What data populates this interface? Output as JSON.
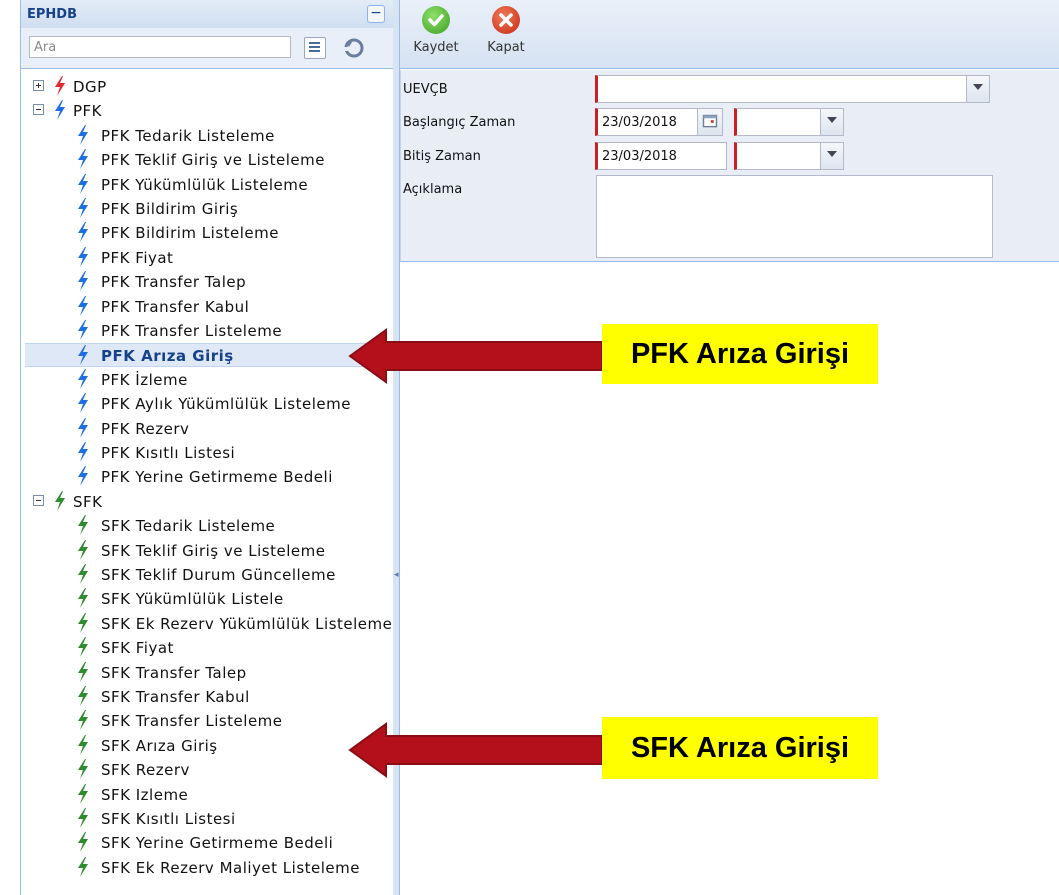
{
  "left_panel": {
    "title": "EPHDB",
    "search_placeholder": "Ara"
  },
  "tree": {
    "nodes": [
      {
        "label": "DGP",
        "level": 0,
        "expander": "plus",
        "bolt": "#e0262e"
      },
      {
        "label": "PFK",
        "level": 0,
        "expander": "minus",
        "bolt": "#1f6fe0"
      },
      {
        "label": "PFK Tedarik Listeleme",
        "level": 1,
        "bolt": "#1f6fe0"
      },
      {
        "label": "PFK Teklif Giriş ve Listeleme",
        "level": 1,
        "bolt": "#1f6fe0"
      },
      {
        "label": "PFK Yükümlülük Listeleme",
        "level": 1,
        "bolt": "#1f6fe0"
      },
      {
        "label": "PFK Bildirim Giriş",
        "level": 1,
        "bolt": "#1f6fe0"
      },
      {
        "label": "PFK Bildirim Listeleme",
        "level": 1,
        "bolt": "#1f6fe0"
      },
      {
        "label": "PFK Fiyat",
        "level": 1,
        "bolt": "#1f6fe0"
      },
      {
        "label": "PFK Transfer Talep",
        "level": 1,
        "bolt": "#1f6fe0"
      },
      {
        "label": "PFK Transfer Kabul",
        "level": 1,
        "bolt": "#1f6fe0"
      },
      {
        "label": "PFK Transfer Listeleme",
        "level": 1,
        "bolt": "#1f6fe0"
      },
      {
        "label": "PFK Arıza Giriş",
        "level": 1,
        "bolt": "#1f6fe0",
        "selected": true
      },
      {
        "label": "PFK İzleme",
        "level": 1,
        "bolt": "#1f6fe0"
      },
      {
        "label": "PFK Aylık Yükümlülük Listeleme",
        "level": 1,
        "bolt": "#1f6fe0"
      },
      {
        "label": "PFK Rezerv",
        "level": 1,
        "bolt": "#1f6fe0"
      },
      {
        "label": "PFK Kısıtlı Listesi",
        "level": 1,
        "bolt": "#1f6fe0"
      },
      {
        "label": "PFK Yerine Getirmeme Bedeli",
        "level": 1,
        "bolt": "#1f6fe0"
      },
      {
        "label": "SFK",
        "level": 0,
        "expander": "minus",
        "bolt": "#2e8b2e"
      },
      {
        "label": "SFK Tedarik Listeleme",
        "level": 1,
        "bolt": "#2e8b2e"
      },
      {
        "label": "SFK Teklif Giriş ve Listeleme",
        "level": 1,
        "bolt": "#2e8b2e"
      },
      {
        "label": "SFK Teklif Durum Güncelleme",
        "level": 1,
        "bolt": "#2e8b2e"
      },
      {
        "label": "SFK Yükümlülük Listele",
        "level": 1,
        "bolt": "#2e8b2e"
      },
      {
        "label": "SFK Ek Rezerv Yükümlülük Listeleme",
        "level": 1,
        "bolt": "#2e8b2e"
      },
      {
        "label": "SFK Fiyat",
        "level": 1,
        "bolt": "#2e8b2e"
      },
      {
        "label": "SFK Transfer Talep",
        "level": 1,
        "bolt": "#2e8b2e"
      },
      {
        "label": "SFK Transfer Kabul",
        "level": 1,
        "bolt": "#2e8b2e"
      },
      {
        "label": "SFK Transfer Listeleme",
        "level": 1,
        "bolt": "#2e8b2e"
      },
      {
        "label": "SFK Arıza Giriş",
        "level": 1,
        "bolt": "#2e8b2e"
      },
      {
        "label": "SFK Rezerv",
        "level": 1,
        "bolt": "#2e8b2e"
      },
      {
        "label": "SFK Izleme",
        "level": 1,
        "bolt": "#2e8b2e"
      },
      {
        "label": "SFK Kısıtlı Listesi",
        "level": 1,
        "bolt": "#2e8b2e"
      },
      {
        "label": "SFK Yerine Getirmeme Bedeli",
        "level": 1,
        "bolt": "#2e8b2e"
      },
      {
        "label": "SFK Ek Rezerv Maliyet Listeleme",
        "level": 1,
        "bolt": "#2e8b2e"
      }
    ]
  },
  "toolbar": {
    "save_label": "Kaydet",
    "close_label": "Kapat"
  },
  "form": {
    "uevcb_label": "UEVÇB",
    "uevcb_value": "",
    "start_label": "Başlangıç Zaman",
    "start_date": "23/03/2018",
    "start_time": "",
    "end_label": "Bitiş Zaman",
    "end_date": "23/03/2018",
    "end_time": "",
    "desc_label": "Açıklama",
    "desc_value": ""
  },
  "annotations": {
    "pfk_callout": "PFK Arıza Girişi",
    "sfk_callout": "SFK Arıza Girişi"
  },
  "colors": {
    "annotation_arrow": "#b3101b",
    "callout_bg": "#ffff00",
    "save_green": "#4caf2e",
    "close_red": "#d93a1f"
  }
}
